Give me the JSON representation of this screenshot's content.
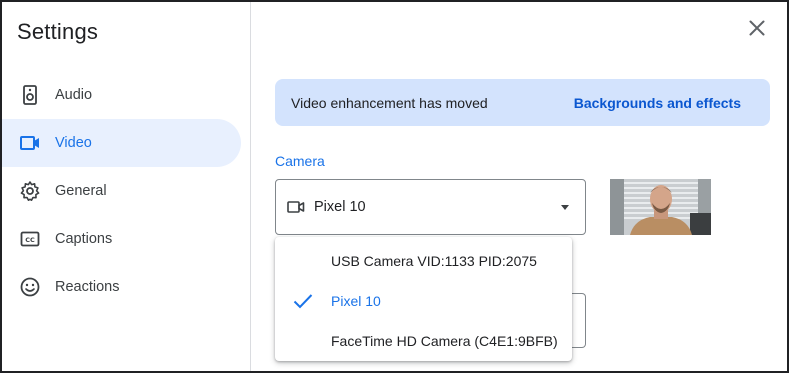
{
  "dialog": {
    "title": "Settings",
    "close_icon": "close-icon"
  },
  "sidebar": {
    "items": [
      {
        "label": "Audio",
        "icon": "speaker-icon",
        "active": false
      },
      {
        "label": "Video",
        "icon": "videocam-icon",
        "active": true
      },
      {
        "label": "General",
        "icon": "gear-icon",
        "active": false
      },
      {
        "label": "Captions",
        "icon": "closed-captions-icon",
        "active": false
      },
      {
        "label": "Reactions",
        "icon": "smiley-icon",
        "active": false
      }
    ]
  },
  "banner": {
    "text": "Video enhancement has moved",
    "link": "Backgrounds and effects"
  },
  "camera": {
    "label": "Camera",
    "selected": "Pixel 10",
    "options": [
      {
        "label": "USB Camera VID:1133 PID:2075",
        "selected": false
      },
      {
        "label": "Pixel 10",
        "selected": true
      },
      {
        "label": "FaceTime HD Camera (C4E1:9BFB)",
        "selected": false
      }
    ]
  },
  "colors": {
    "accent": "#1a73e8",
    "active_bg": "#e8f0fe",
    "banner_bg": "#d3e3fd",
    "link": "#0b57d0"
  }
}
